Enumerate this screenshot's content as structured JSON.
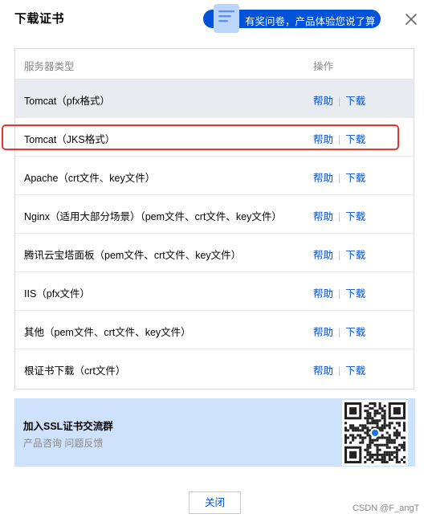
{
  "dialog": {
    "title": "下载证书",
    "survey_label": "有奖问卷，产品体验您说了算",
    "close_label": "关闭"
  },
  "table": {
    "headers": {
      "type": "服务器类型",
      "ops": "操作"
    },
    "help_label": "帮助",
    "download_label": "下载",
    "separator": "|",
    "rows": [
      {
        "name": "Tomcat（pfx格式）"
      },
      {
        "name": "Tomcat（JKS格式）"
      },
      {
        "name": "Apache（crt文件、key文件）"
      },
      {
        "name": "Nginx（适用大部分场景）（pem文件、crt文件、key文件）"
      },
      {
        "name": "腾讯云宝塔面板（pem文件、crt文件、key文件）"
      },
      {
        "name": "IIS（pfx文件）"
      },
      {
        "name": "其他（pem文件、crt文件、key文件）"
      },
      {
        "name": "根证书下载（crt文件）"
      }
    ],
    "hover_row": 1,
    "marked_row": 2
  },
  "banner": {
    "title": "加入SSL证书交流群",
    "subtitle": "产品咨询 问题反馈"
  },
  "watermark": "CSDN @F_angT",
  "colors": {
    "accent": "#0052d9",
    "highlight_box": "#e8362d",
    "banner_bg": "#cfe2fb"
  }
}
